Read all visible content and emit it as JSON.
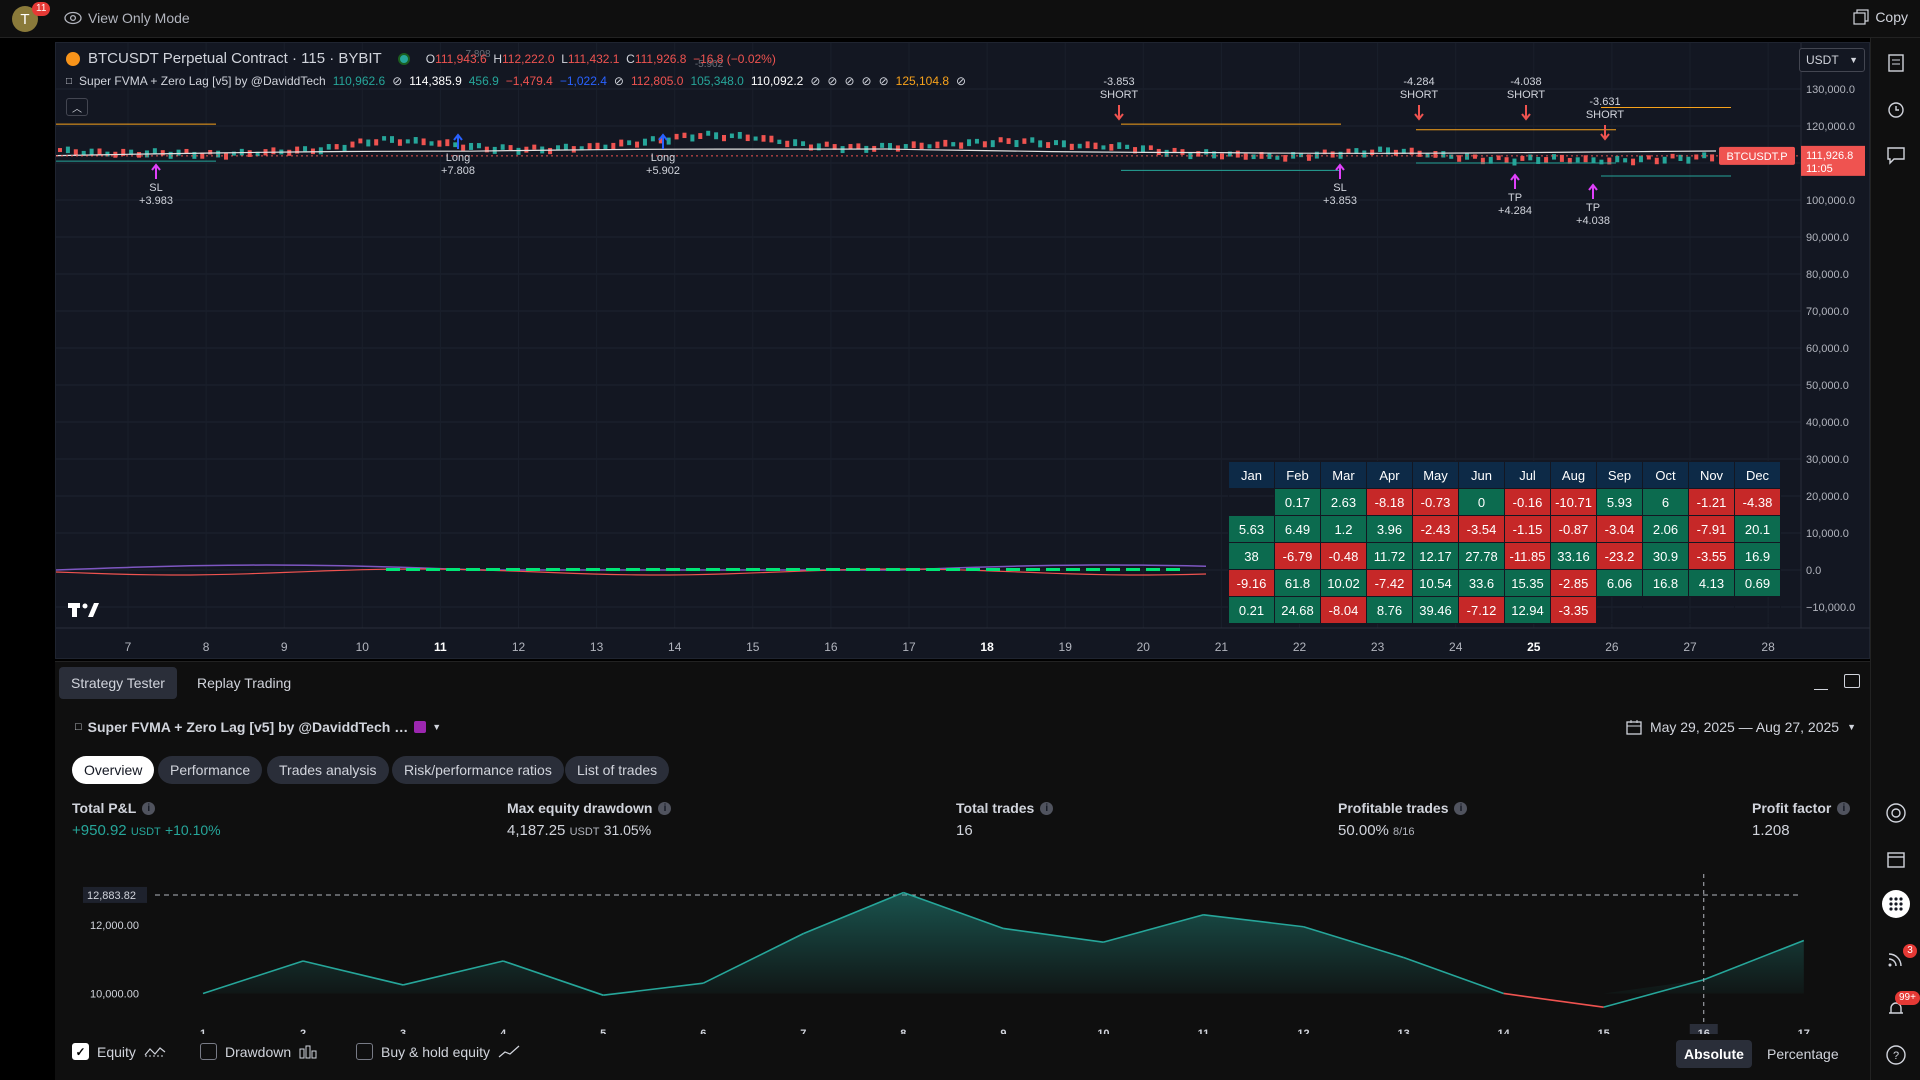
{
  "topbar": {
    "avatar_letter": "T",
    "avatar_badge": "11",
    "view_mode": "View Only Mode",
    "copy_label": "Copy"
  },
  "chart": {
    "symbol": "BTCUSDT Perpetual Contract · 115 · BYBIT",
    "ohlc": [
      {
        "k": "O",
        "v": "111,943.6"
      },
      {
        "k": "H",
        "v": "112,222.0"
      },
      {
        "k": "L",
        "v": "111,432.1"
      },
      {
        "k": "C",
        "v": "111,926.8"
      }
    ],
    "change": "−16.8 (−0.02%)",
    "indicator": {
      "name": "Super FVMA + Zero Lag [v5] by @DaviddTech",
      "values": [
        {
          "v": "110,962.6",
          "c": "#26a69a"
        },
        {
          "v": "114,385.9",
          "c": "#ffffff"
        },
        {
          "v": "456.9",
          "c": "#26a69a"
        },
        {
          "v": "−1,479.4",
          "c": "#ef5350"
        },
        {
          "v": "−1,022.4",
          "c": "#2962ff"
        },
        {
          "v": "112,805.0",
          "c": "#ef5350"
        },
        {
          "v": "105,348.0",
          "c": "#26a69a"
        },
        {
          "v": "110,092.2",
          "c": "#ffffff"
        },
        {
          "v": "125,104.8",
          "c": "#f7a21b"
        }
      ]
    },
    "currency": "USDT",
    "y_ticks": [
      "130,000.0",
      "120,000.0",
      "110,000.0",
      "100,000.0",
      "90,000.0",
      "80,000.0",
      "70,000.0",
      "60,000.0",
      "50,000.0",
      "40,000.0",
      "30,000.0",
      "20,000.0",
      "10,000.0",
      "0.0",
      "−10,000.0"
    ],
    "x_ticks": [
      "7",
      "8",
      "9",
      "10",
      "11",
      "12",
      "13",
      "14",
      "15",
      "16",
      "17",
      "18",
      "19",
      "20",
      "21",
      "22",
      "23",
      "24",
      "25",
      "26",
      "27",
      "28"
    ],
    "price_tag": {
      "symbol": "BTCUSDT.P",
      "price": "111,926.8",
      "countdown": "11:05"
    },
    "trade_labels": [
      {
        "t": "SL",
        "v": "+3.983"
      },
      {
        "t": "Long",
        "v": "+7.808"
      },
      {
        "t": "Long",
        "v": "+5.902"
      },
      {
        "t": "SHORT",
        "v": "-3.853"
      },
      {
        "t": "SL",
        "v": "+3.853"
      },
      {
        "t": "SHORT",
        "v": "-4.284"
      },
      {
        "t": "SHORT",
        "v": "-4.038"
      },
      {
        "t": "TP",
        "v": "+4.284"
      },
      {
        "t": "SHORT",
        "v": "-3.631"
      },
      {
        "t": "TP",
        "v": "+4.038"
      }
    ],
    "faint_labels": [
      "7.808",
      "-5.902"
    ],
    "monthly_table": {
      "months": [
        "Jan",
        "Feb",
        "Mar",
        "Apr",
        "May",
        "Jun",
        "Jul",
        "Aug",
        "Sep",
        "Oct",
        "Nov",
        "Dec"
      ],
      "rows": [
        [
          "",
          "0.17",
          "2.63",
          "-8.18",
          "-0.73",
          "0",
          "-0.16",
          "-10.71",
          "5.93",
          "6",
          "-1.21",
          "-4.38"
        ],
        [
          "5.63",
          "6.49",
          "1.2",
          "3.96",
          "-2.43",
          "-3.54",
          "-1.15",
          "-0.87",
          "-3.04",
          "2.06",
          "-7.91",
          "20.1"
        ],
        [
          "38",
          "-6.79",
          "-0.48",
          "11.72",
          "12.17",
          "27.78",
          "-11.85",
          "33.16",
          "-23.2",
          "30.9",
          "-3.55",
          "16.9"
        ],
        [
          "-9.16",
          "61.8",
          "10.02",
          "-7.42",
          "10.54",
          "33.6",
          "15.35",
          "-2.85",
          "6.06",
          "16.8",
          "4.13",
          "0.69"
        ],
        [
          "0.21",
          "24.68",
          "-8.04",
          "8.76",
          "39.46",
          "-7.12",
          "12.94",
          "-3.35",
          "",
          "",
          "",
          ""
        ]
      ]
    }
  },
  "panel": {
    "tabs": [
      "Strategy Tester",
      "Replay Trading"
    ],
    "strategy_name": "Super FVMA + Zero Lag [v5] by @DaviddTech …",
    "date_range": "May 29, 2025 — Aug 27, 2025",
    "subtabs": [
      "Overview",
      "Performance",
      "Trades analysis",
      "Risk/performance ratios",
      "List of trades"
    ],
    "metrics": {
      "total_pnl": {
        "label": "Total P&L",
        "value": "+950.92",
        "unit": "USDT",
        "pct": "+10.10%"
      },
      "max_dd": {
        "label": "Max equity drawdown",
        "value": "4,187.25",
        "unit": "USDT",
        "pct": "31.05%"
      },
      "total_trades": {
        "label": "Total trades",
        "value": "16"
      },
      "profitable": {
        "label": "Profitable trades",
        "value": "50.00%",
        "sub": "8/16"
      },
      "profit_factor": {
        "label": "Profit factor",
        "value": "1.208"
      }
    },
    "checkboxes": {
      "equity": "Equity",
      "drawdown": "Drawdown",
      "buyhold": "Buy & hold equity"
    },
    "segments": {
      "absolute": "Absolute",
      "percentage": "Percentage"
    }
  },
  "chart_data": {
    "type": "area",
    "x": [
      1,
      2,
      3,
      4,
      5,
      6,
      7,
      8,
      9,
      10,
      11,
      12,
      13,
      14,
      15,
      16,
      17
    ],
    "values": [
      10000,
      10950,
      10250,
      10950,
      9950,
      10300,
      11750,
      12950,
      11900,
      11500,
      12300,
      11950,
      11050,
      10000,
      9600,
      10400,
      11550
    ],
    "y_ticks": [
      "12,000.00",
      "10,000.00"
    ],
    "max_label": "12,883.82",
    "baseline": 10000,
    "ylim": [
      9400,
      13200
    ],
    "legend": "bottom-left",
    "colors": {
      "above": "#26a69a",
      "below": "#ef5350"
    }
  },
  "colors": {
    "green_cell": "#0c6b4f",
    "red_cell": "#c62828",
    "accent": "#26a69a"
  }
}
